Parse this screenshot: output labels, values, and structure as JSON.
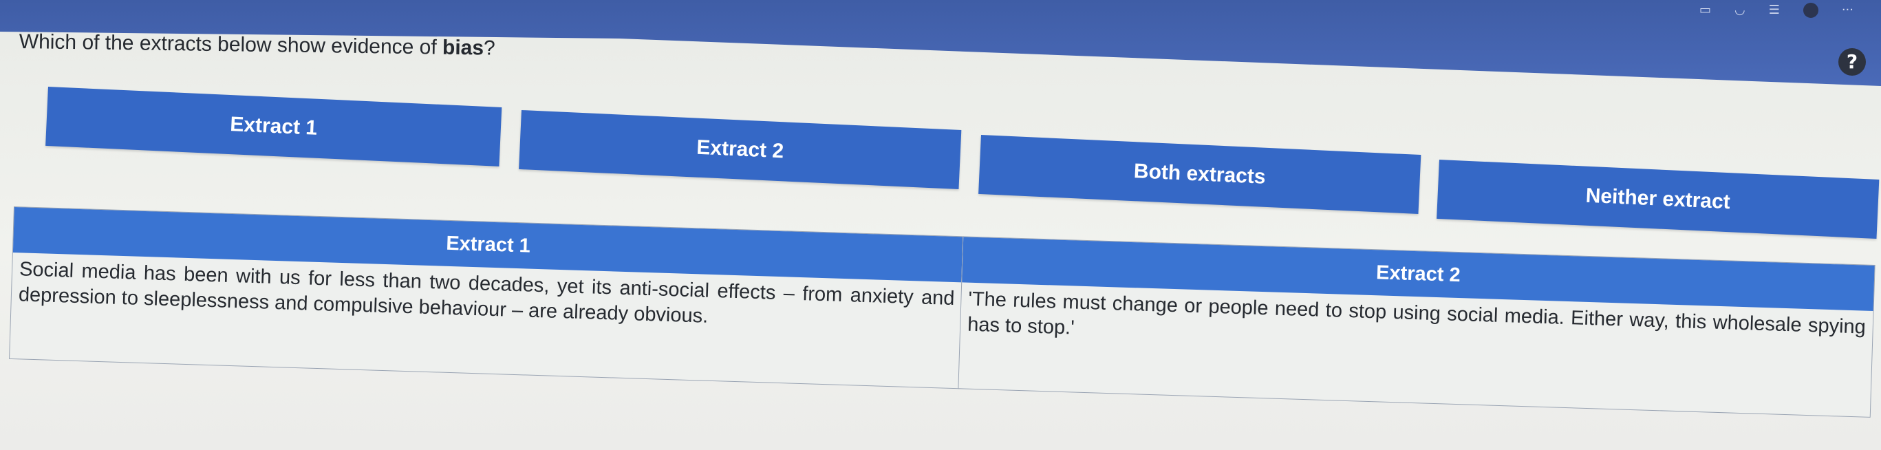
{
  "question": {
    "prefix": "Which of the extracts below show evidence of ",
    "keyword": "bias",
    "suffix": "?"
  },
  "help_label": "?",
  "answers": [
    "Extract 1",
    "Extract 2",
    "Both extracts",
    "Neither extract"
  ],
  "extracts": [
    {
      "title": "Extract 1",
      "text": "Social media has been with us for less than two decades, yet its anti-social effects – from anxiety and depression to sleeplessness and compulsive behaviour – are already obvious."
    },
    {
      "title": "Extract 2",
      "text": "'The rules must change or people need to stop using social media. Either way, this wholesale spying has to stop.'"
    }
  ]
}
